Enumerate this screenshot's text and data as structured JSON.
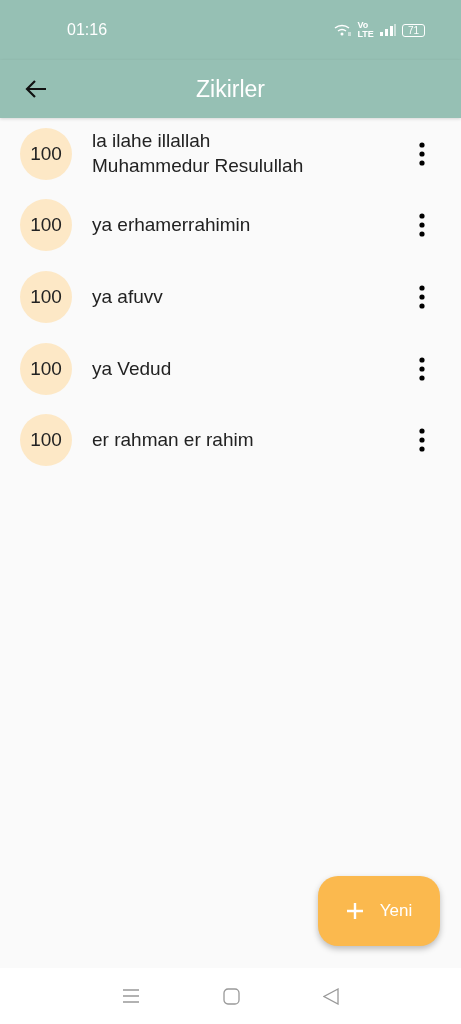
{
  "status_bar": {
    "time": "01:16",
    "network_label": [
      "Vo",
      "LTE"
    ],
    "battery": "71"
  },
  "app_bar": {
    "title": "Zikirler"
  },
  "items": [
    {
      "count": "100",
      "lines": [
        "la ilahe illallah",
        "Muhammedur Resulullah"
      ]
    },
    {
      "count": "100",
      "lines": [
        "ya erhamerrahimin"
      ]
    },
    {
      "count": "100",
      "lines": [
        "ya afuvv"
      ]
    },
    {
      "count": "100",
      "lines": [
        "ya Vedud"
      ]
    },
    {
      "count": "100",
      "lines": [
        "er rahman er rahim"
      ]
    }
  ],
  "fab": {
    "label": "Yeni"
  }
}
